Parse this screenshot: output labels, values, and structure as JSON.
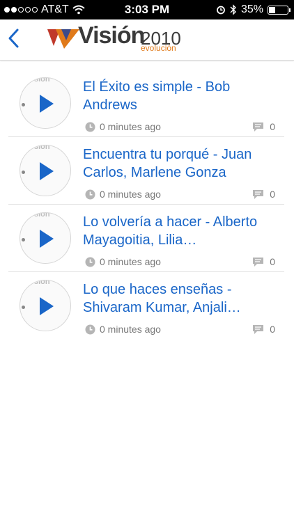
{
  "status_bar": {
    "carrier": "AT&T",
    "time": "3:03 PM",
    "battery": "35%"
  },
  "header": {
    "logo_word": "Visión",
    "logo_year": "2010",
    "logo_sub": "evolución"
  },
  "items": [
    {
      "title": "El Éxito es simple - Bob Andrews",
      "time": "0 minutes ago",
      "comments": "0",
      "thumb_mark": "sión"
    },
    {
      "title": "Encuentra tu porqué - Juan Carlos, Marlene Gonza",
      "time": "0 minutes ago",
      "comments": "0",
      "thumb_mark": "sión"
    },
    {
      "title": "Lo volvería a hacer - Alberto Mayagoitia, Lilia…",
      "time": "0 minutes ago",
      "comments": "0",
      "thumb_mark": "sión"
    },
    {
      "title": "Lo que haces enseñas - Shivaram Kumar, Anjali…",
      "time": "0 minutes ago",
      "comments": "0",
      "thumb_mark": "sión"
    }
  ],
  "colors": {
    "accent": "#1a66c8",
    "logo_orange": "#e07a1a",
    "meta_gray": "#777777"
  }
}
